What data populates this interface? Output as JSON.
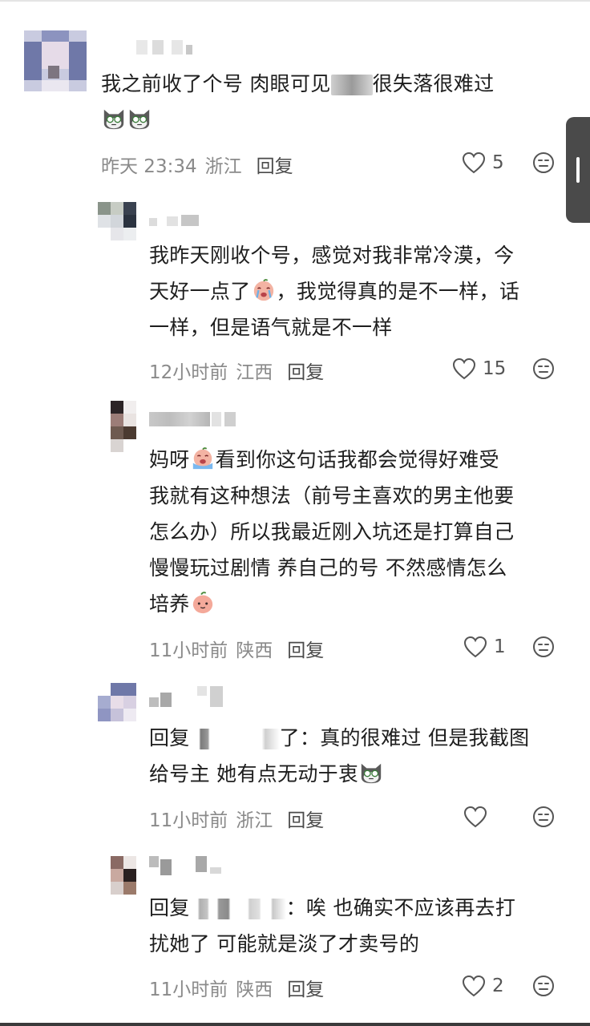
{
  "comments": [
    {
      "lines": [
        "我之前收了个号 肉眼可见",
        "很失落很难过"
      ],
      "time": "昨天 23:34",
      "location": "浙江",
      "reply_label": "回复",
      "likes": "5"
    },
    {
      "lines": [
        "我昨天刚收个号，感觉对我非常冷漠，今",
        "天好一点了",
        "，我觉得真的是不一样，话",
        "一样，但是语气就是不一样"
      ],
      "time": "12小时前",
      "location": "江西",
      "reply_label": "回复",
      "likes": "15"
    },
    {
      "lines": [
        "妈呀",
        "看到你这句话我都会觉得好难受",
        "我就有这种想法（前号主喜欢的男主他要",
        "怎么办）所以我最近刚入坑还是打算自己",
        "慢慢玩过剧情 养自己的号 不然感情怎么",
        "培养"
      ],
      "time": "11小时前",
      "location": "陕西",
      "reply_label": "回复",
      "likes": "1"
    },
    {
      "lines": [
        "回复",
        "了：真的很难过 但是我截图",
        "给号主",
        " 她有点无动于衷"
      ],
      "time": "11小时前",
      "location": "浙江",
      "reply_label": "回复",
      "likes": ""
    },
    {
      "lines": [
        "回复",
        "：唉 也确实不应该再去打",
        "扰她了 可能就是淡了才卖号的"
      ],
      "time": "11小时前",
      "location": "陕西",
      "reply_label": "回复",
      "likes": "2"
    }
  ],
  "icons": {
    "like": "heart-outline-icon",
    "dislike": "neutral-face-icon",
    "emoji_cat": "gray-cat-emoji",
    "emoji_cry": "crying-face-emoji",
    "emoji_peach": "peach-face-emoji"
  },
  "colors": {
    "text": "#1e1e1e",
    "meta": "#8a8a8a",
    "reply": "#4a4a4a",
    "scroll_handle": "#4a4a4a"
  }
}
